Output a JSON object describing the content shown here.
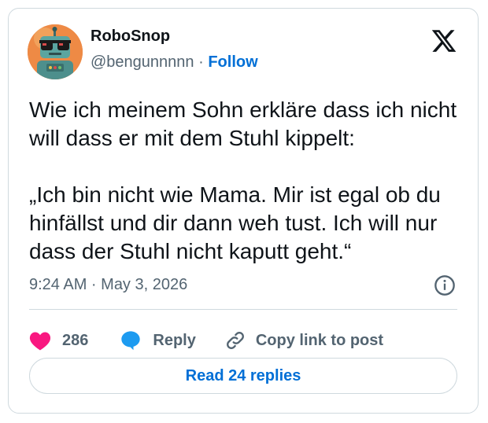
{
  "author": {
    "display_name": "RoboSnop",
    "handle": "@bengunnnnn",
    "separator": " · ",
    "follow_label": "Follow",
    "avatar_icon": "robot-avatar"
  },
  "brand": {
    "logo_icon": "x-logo-icon"
  },
  "tweet": {
    "paragraph_1": "Wie ich meinem Sohn erkläre dass ich nicht will dass er mit dem Stuhl kippelt:",
    "paragraph_2": "„Ich bin nicht wie Mama. Mir ist egal ob du hinfällst und dir dann weh tust. Ich will nur dass der Stuhl nicht kaputt geht.“",
    "timestamp": "9:24 AM · May 3, 2026"
  },
  "actions": {
    "like_count": "286",
    "reply_label": "Reply",
    "copy_label": "Copy link to post"
  },
  "read_replies_label": "Read 24 replies",
  "colors": {
    "accent": "#006fd6",
    "like": "#f91880",
    "reply": "#1d9bf0",
    "muted": "#536471",
    "border": "#cfd9de"
  }
}
